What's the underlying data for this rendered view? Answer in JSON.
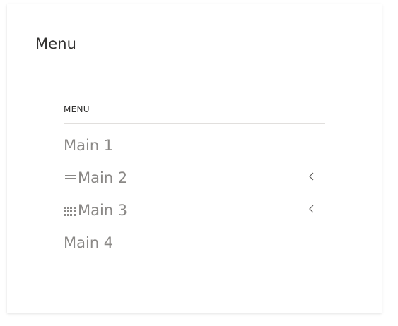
{
  "card": {
    "title": "Menu"
  },
  "menu": {
    "header": "MENU",
    "items": [
      {
        "label": "Main 1",
        "icon": null,
        "has_submenu": false
      },
      {
        "label": "Main 2",
        "icon": "hamburger-icon",
        "has_submenu": true
      },
      {
        "label": "Main 3",
        "icon": "dots-grid-icon",
        "has_submenu": true
      },
      {
        "label": "Main 4",
        "icon": null,
        "has_submenu": false
      }
    ]
  },
  "colors": {
    "title_text": "#323130",
    "item_text": "#8a8886",
    "divider": "#e1dfdd",
    "chevron": "#605e5c"
  }
}
